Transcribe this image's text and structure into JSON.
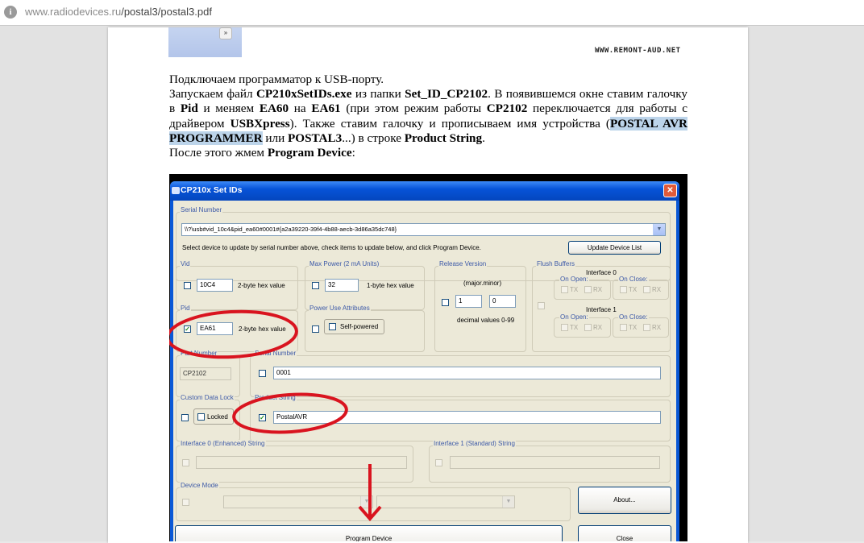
{
  "browser": {
    "url_host": "www.radiodevices.ru",
    "url_path": "/postal3/postal3.pdf"
  },
  "pdf": {
    "watermark": "WWW.REMONT-AUD.NET",
    "paragraph1": "Подключаем программатор к USB-порту.",
    "p2_a": "Запускаем файл ",
    "p2_b": "CP210xSetIDs.exe",
    "p2_c": " из папки ",
    "p2_d": "Set_ID_CP2102",
    "p2_e": ". В появившемся окне ставим галочку в ",
    "p2_f": "Pid",
    "p2_g": " и меняем ",
    "p2_h": "EA60",
    "p2_i": " на ",
    "p2_j": "EA61",
    "p2_k": " (при этом режим работы ",
    "p2_l": "CP2102",
    "p2_m": " переключается для работы с драйвером ",
    "p2_n": "USBXpress",
    "p2_o": "). Также ставим галочку и прописываем имя устройства (",
    "p2_p": "POSTAL AVR PROGRAMMER",
    "p2_q": " или ",
    "p2_r": "POSTAL3",
    "p2_s": "...) в строке ",
    "p2_t": "Product String",
    "p2_u": ".",
    "p3_a": "После этого жмем ",
    "p3_b": "Program Device",
    "p3_c": ":"
  },
  "dialog": {
    "title": "CP210x Set IDs",
    "close_glyph": "✕",
    "serial_group": "Serial Number",
    "serial_value": "\\\\?\\usb#vid_10c4&pid_ea60#0001#{a2a39220-39f4-4b88-aecb-3d86a35dc748}",
    "hint": "Select device to update by serial number above, check items to update below, and click Program Device.",
    "update_list": "Update Device List",
    "vid_group": "Vid",
    "vid_value": "10C4",
    "hex_label": "2-byte hex value",
    "pid_group": "Pid",
    "pid_value": "EA61",
    "maxpower_group": "Max Power (2 mA Units)",
    "maxpower_value": "32",
    "hex1_label": "1-byte hex value",
    "poweruse_group": "Power Use Attributes",
    "selfpowered": "Self-powered",
    "release_group": "Release Version",
    "major_minor": "(major.minor)",
    "rel_major": "1",
    "rel_minor": "0",
    "decimal_label": "decimal values 0-99",
    "flush_group": "Flush Buffers",
    "iface0": "Interface 0",
    "iface1": "Interface 1",
    "on_open": "On Open:",
    "on_close": "On Close:",
    "tx": "TX",
    "rx": "RX",
    "part_group": "Part Number",
    "part_value": "CP2102",
    "serial2_group": "Serial Number",
    "serial2_value": "0001",
    "lock_group": "Custom Data Lock",
    "locked": "Locked",
    "product_group": "Product String",
    "product_value": "PostalAVR",
    "if0_group": "Interface 0 (Enhanced) String",
    "if1_group": "Interface 1 (Standard) String",
    "mode_group": "Device Mode",
    "about": "About...",
    "program": "Program Device",
    "close": "Close"
  },
  "colors": {
    "annotation_red": "#d9141f",
    "title_blue": "#0653d8"
  }
}
